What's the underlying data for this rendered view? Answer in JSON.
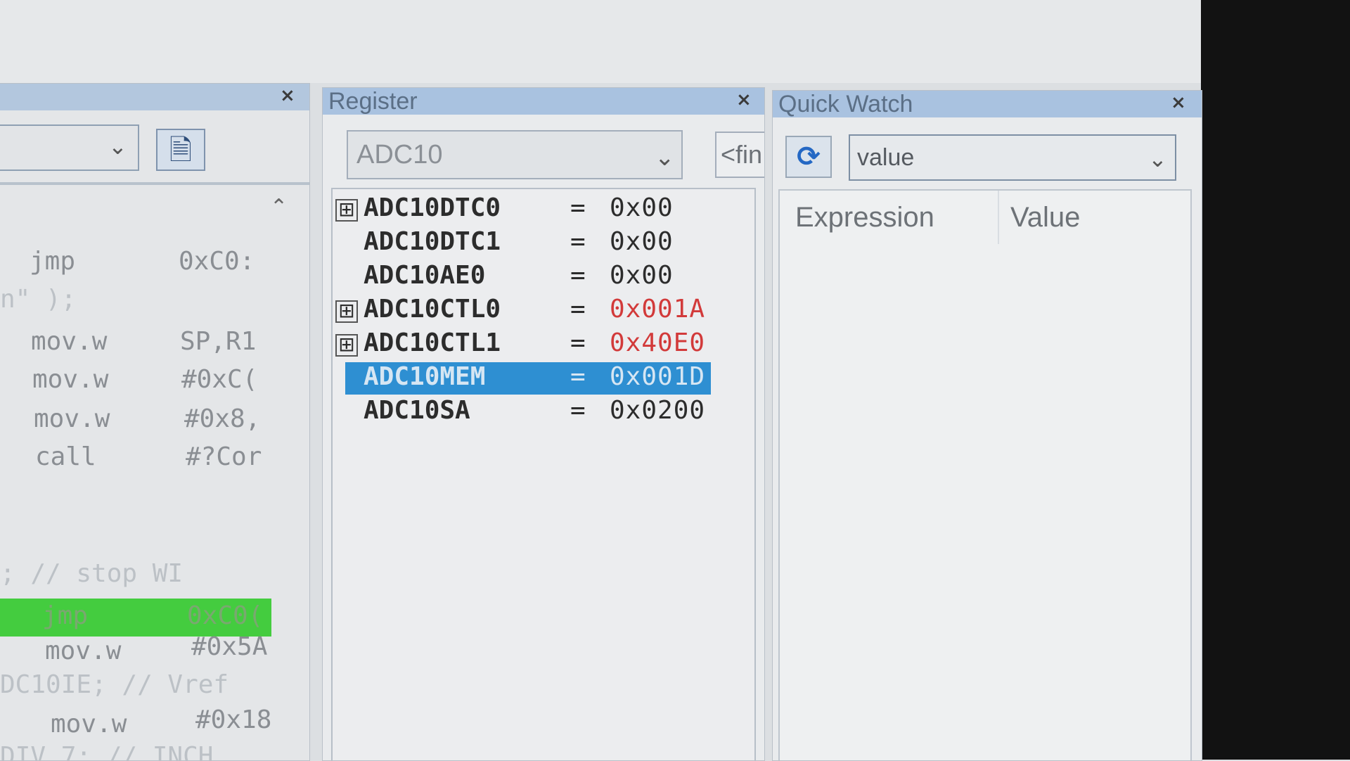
{
  "disassembly": {
    "lines": [
      {
        "mnemonic": "jmp",
        "operand": "0xC0:"
      },
      {
        "comment": "n\" );"
      },
      {
        "mnemonic": "mov.w",
        "operand": "SP,R1"
      },
      {
        "mnemonic": "mov.w",
        "operand": "#0xC("
      },
      {
        "mnemonic": "mov.w",
        "operand": "#0x8,"
      },
      {
        "mnemonic": "call",
        "operand": "#?Cor"
      },
      {
        "mnemonic": "jmp",
        "operand": "0xC0("
      },
      {
        "comment": ";   // stop WI"
      },
      {
        "mnemonic": "mov.w",
        "operand": "#0x5A"
      },
      {
        "comment": "DC10IE;  // Vref"
      },
      {
        "mnemonic": "mov.w",
        "operand": "#0x18"
      },
      {
        "comment": "DIV_7;  // INCH"
      }
    ]
  },
  "register": {
    "title": "Register",
    "close": "×",
    "group": "ADC10",
    "find_placeholder": "<fin",
    "rows": [
      {
        "expandable": "⊞",
        "name": "ADC10DTC0",
        "eq": "=",
        "value": "0x00"
      },
      {
        "expandable": "",
        "name": "ADC10DTC1",
        "eq": "=",
        "value": "0x00"
      },
      {
        "expandable": "",
        "name": "ADC10AE0",
        "eq": "=",
        "value": "0x00"
      },
      {
        "expandable": "⊞",
        "name": "ADC10CTL0",
        "eq": "=",
        "value": "0x001A"
      },
      {
        "expandable": "⊞",
        "name": "ADC10CTL1",
        "eq": "=",
        "value": "0x40E0"
      },
      {
        "expandable": "",
        "name": "ADC10MEM",
        "eq": "=",
        "value": "0x001D"
      },
      {
        "expandable": "",
        "name": "ADC10SA",
        "eq": "=",
        "value": "0x0200"
      }
    ]
  },
  "quickwatch": {
    "title": "Quick Watch",
    "close": "×",
    "expression": "value",
    "columns": [
      "Expression",
      "Value"
    ]
  },
  "left_close": "×",
  "colors": {
    "changed_value": "#d23a3a",
    "selection": "#2e8fd2",
    "current_line": "#44cc3f",
    "title_bar": "#a9c2e0"
  },
  "icons": {
    "expand": "plus-box-icon",
    "refresh": "refresh-icon",
    "dropdown": "chevron-down-icon",
    "document": "document-icon"
  }
}
